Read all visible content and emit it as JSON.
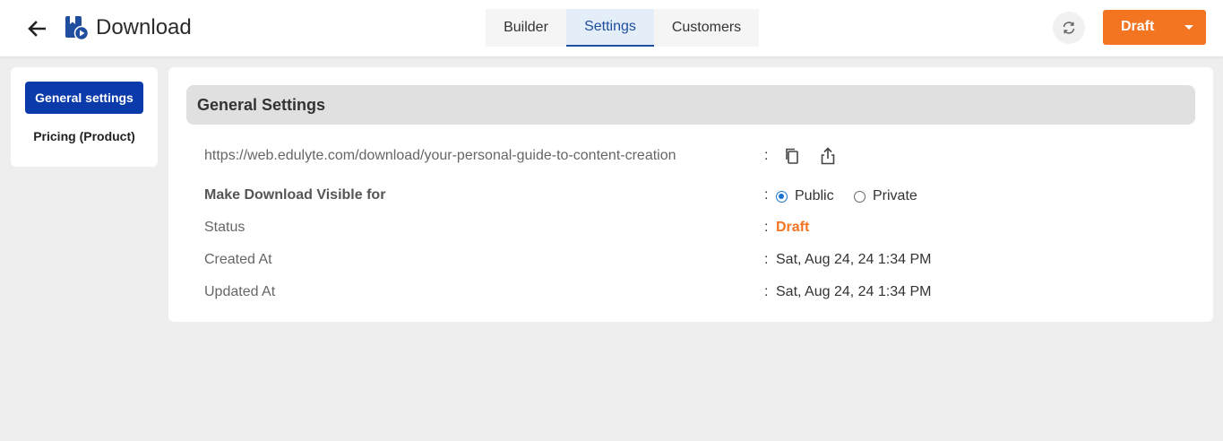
{
  "header": {
    "title": "Download",
    "back_icon": "arrow-left-icon",
    "app_icon": "download-product-icon",
    "tabs": [
      {
        "label": "Builder"
      },
      {
        "label": "Settings"
      },
      {
        "label": "Customers"
      }
    ],
    "active_tab": "Settings",
    "sync_icon": "sync-icon",
    "status_button": {
      "label": "Draft",
      "color": "#f47521"
    }
  },
  "sidebar": {
    "items": [
      {
        "label": "General settings"
      },
      {
        "label": "Pricing (Product)"
      }
    ],
    "active": "General settings",
    "accent": "#0b3bab"
  },
  "main": {
    "heading": "General Settings",
    "url": "https://web.edulyte.com/download/your-personal-guide-to-content-creation",
    "visibility": {
      "label": "Make Download Visible for",
      "options": [
        "Public",
        "Private"
      ],
      "selected": "Public"
    },
    "status": {
      "label": "Status",
      "value": "Draft"
    },
    "created": {
      "label": "Created At",
      "value": "Sat, Aug 24, 24 1:34 PM"
    },
    "updated": {
      "label": "Updated At",
      "value": "Sat, Aug 24, 24 1:34 PM"
    },
    "colon": ":"
  }
}
